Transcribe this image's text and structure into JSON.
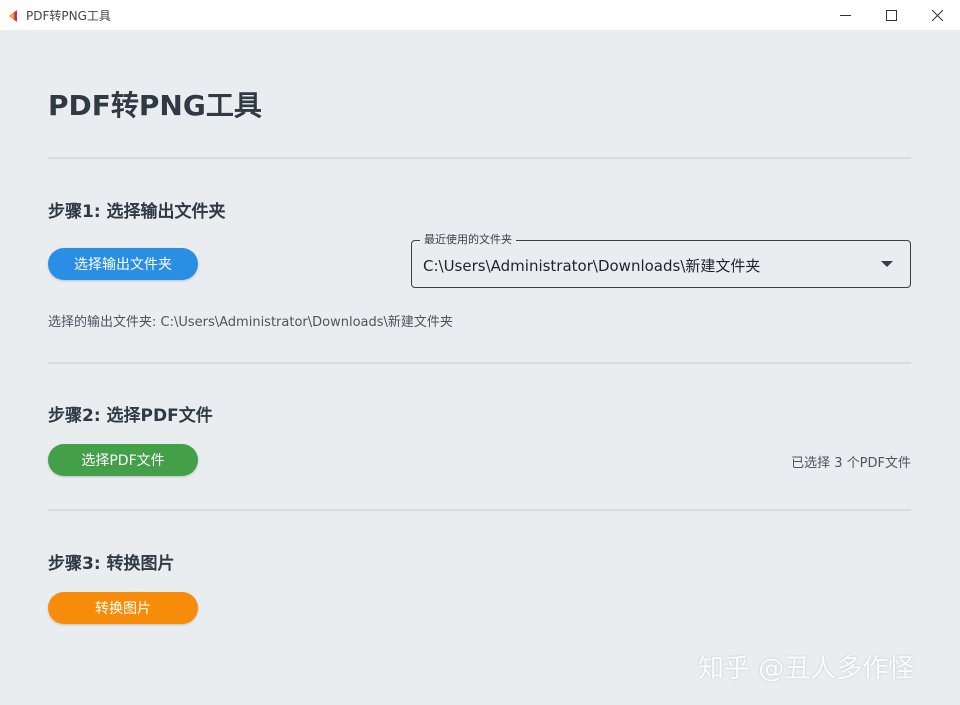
{
  "window": {
    "title": "PDF转PNG工具"
  },
  "page": {
    "title": "PDF转PNG工具"
  },
  "step1": {
    "title": "步骤1: 选择输出文件夹",
    "button_label": "选择输出文件夹",
    "dropdown_label": "最近使用的文件夹",
    "dropdown_value": "C:\\Users\\Administrator\\Downloads\\新建文件夹",
    "selected_folder_text": "选择的输出文件夹: C:\\Users\\Administrator\\Downloads\\新建文件夹"
  },
  "step2": {
    "title": "步骤2: 选择PDF文件",
    "button_label": "选择PDF文件",
    "status_text": "已选择 3 个PDF文件"
  },
  "step3": {
    "title": "步骤3: 转换图片",
    "button_label": "转换图片"
  },
  "watermark": {
    "text": "知乎 @丑人多作怪"
  },
  "colors": {
    "background": "#e9edf0",
    "blue_button": "#2a8fe4",
    "green_button": "#44a048",
    "orange_button": "#f78c0a"
  },
  "icons": {
    "app": "app-logo-icon",
    "minimize": "minimize-icon",
    "maximize": "maximize-icon",
    "close": "close-icon",
    "dropdown": "chevron-down-icon"
  }
}
